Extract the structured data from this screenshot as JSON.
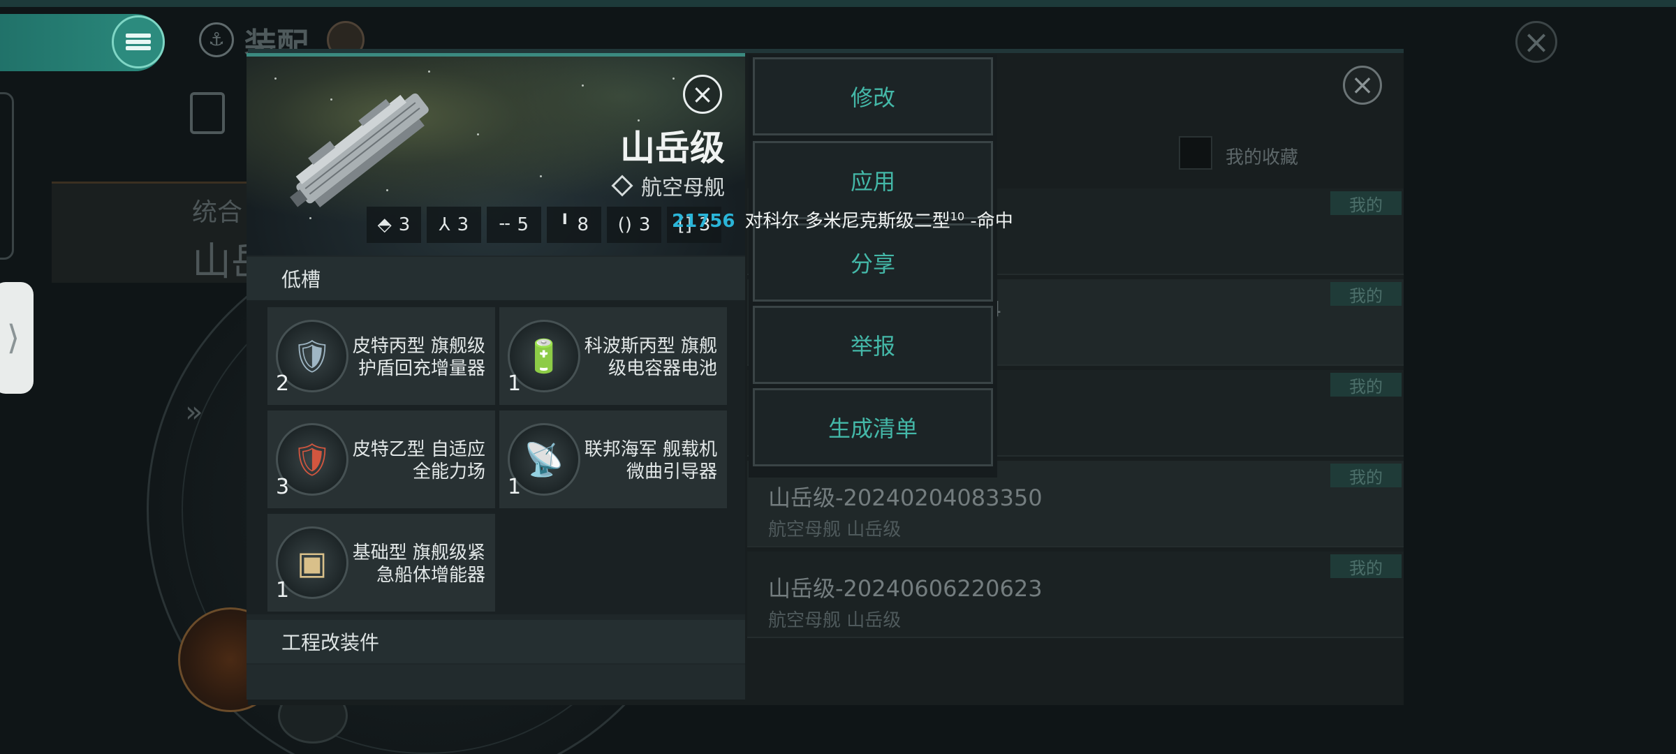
{
  "background": {
    "screen_title": "装配",
    "left_card": {
      "line1": "统合",
      "line2": "山岳"
    }
  },
  "list": {
    "favorites_label": "我的收藏",
    "rows": [
      {
        "badge": "我的",
        "title": "",
        "subtitle": ""
      },
      {
        "badge": "我的",
        "title": "4",
        "subtitle": ""
      },
      {
        "badge": "我的",
        "title": "",
        "subtitle": ""
      },
      {
        "badge": "我的",
        "title": "山岳级-20240204083350",
        "subtitle": "航空母舰 山岳级"
      },
      {
        "badge": "我的",
        "title": "山岳级-20240606220623",
        "subtitle": "航空母舰 山岳级"
      }
    ]
  },
  "popup": {
    "ship_name": "山岳级",
    "ship_class": "航空母舰",
    "slot_stats": [
      {
        "icon": "fighter-bay-icon",
        "glyph": "⬘",
        "value": "3"
      },
      {
        "icon": "drone-icon",
        "glyph": "⅄",
        "value": "3"
      },
      {
        "icon": "high-slot-icon",
        "glyph": "╌",
        "value": "5"
      },
      {
        "icon": "mid-slot-icon",
        "glyph": "╹",
        "value": "8"
      },
      {
        "icon": "low-slot-icon",
        "glyph": "()",
        "value": "3"
      },
      {
        "icon": "rig-slot-icon",
        "glyph": "[]",
        "value": "3"
      }
    ],
    "combat_message": {
      "damage": "21756",
      "text": "对科尔 多米尼克斯级二型",
      "superscript": "10",
      "result": " -命中"
    },
    "low_slot_header": "低槽",
    "modules": [
      {
        "name": "皮特丙型 旗舰级护盾回充增量器",
        "qty": "2",
        "icon": "shield-recharger-icon",
        "glyph": "🛡",
        "color": "#9fb6c4"
      },
      {
        "name": "科波斯丙型 旗舰级电容器电池",
        "qty": "1",
        "icon": "capacitor-battery-icon",
        "glyph": "🔋",
        "color": "#c9d1d6"
      },
      {
        "name": "皮特乙型 自适应全能力场",
        "qty": "3",
        "icon": "adaptive-field-icon",
        "glyph": "🛡",
        "color": "#d2563f"
      },
      {
        "name": "联邦海军 舰载机微曲引导器",
        "qty": "1",
        "icon": "warp-guide-icon",
        "glyph": "📡",
        "color": "#c9a36a"
      },
      {
        "name": "基础型 旗舰级紧急船体增能器",
        "qty": "1",
        "icon": "hull-energizer-icon",
        "glyph": "▣",
        "color": "#d9c08a"
      }
    ],
    "engineering_header": "工程改装件"
  },
  "actions": {
    "modify": "修改",
    "apply": "应用",
    "share": "分享",
    "report": "举报",
    "generate_list": "生成清单"
  },
  "colors": {
    "accent": "#44b8a8",
    "damage": "#2bb5d8",
    "menu_teal": "#2b8a7d"
  }
}
